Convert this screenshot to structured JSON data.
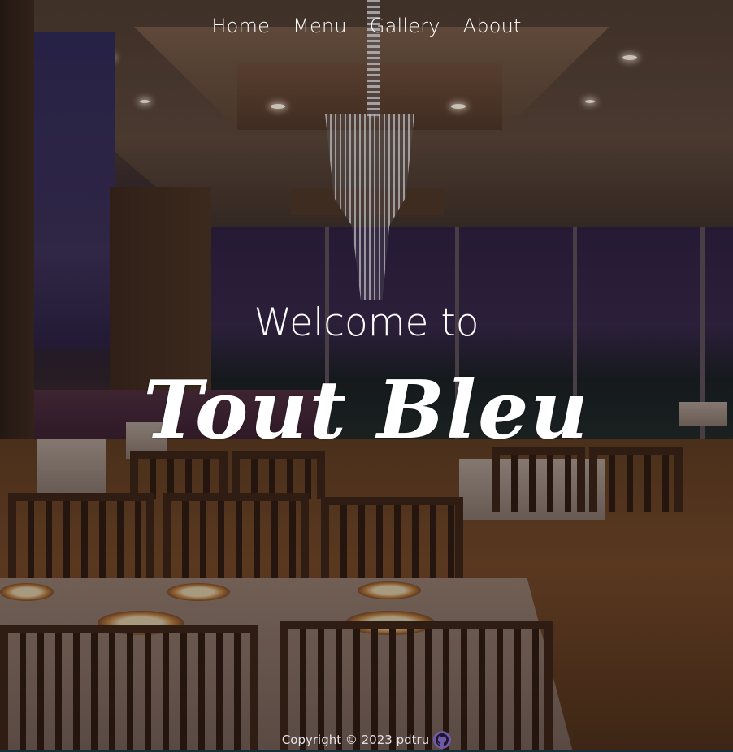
{
  "nav": {
    "items": [
      {
        "label": "Home"
      },
      {
        "label": "Menu"
      },
      {
        "label": "Gallery"
      },
      {
        "label": "About"
      }
    ]
  },
  "hero": {
    "welcome": "Welcome to",
    "brand": "Tout Bleu"
  },
  "footer": {
    "copyright": "Copyright © 2023 pdtru",
    "icon": "github-icon"
  },
  "colors": {
    "text": "#ffffff",
    "footer_text": "#e6e0e6",
    "github_badge": "#6f5aa6"
  }
}
